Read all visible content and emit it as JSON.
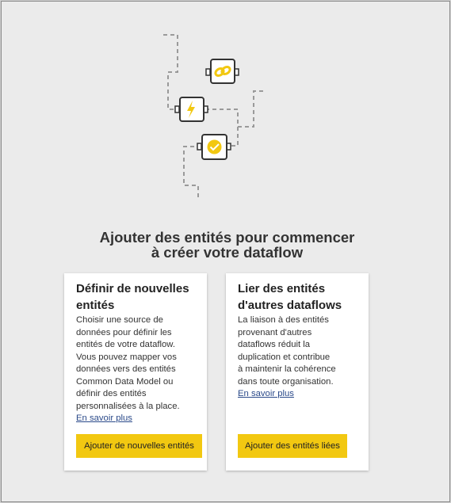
{
  "heading": {
    "line1": "Ajouter des entités pour commencer",
    "line2": "à créer votre dataflow"
  },
  "cards": [
    {
      "title_line1": "Définir de nouvelles",
      "title_line2": "entités",
      "desc_lines": [
        "Choisir une source de",
        "données pour définir les",
        "entités de votre dataflow.",
        "Vous pouvez mapper vos",
        "données vers des entités",
        "Common Data Model ou",
        "définir des entités",
        "personnalisées à la place."
      ],
      "link": "En savoir plus",
      "button": "Ajouter de nouvelles entités"
    },
    {
      "title_line1": "Lier des entités",
      "title_line2": "d'autres dataflows",
      "desc_lines": [
        "La liaison à des entités",
        "provenant d'autres",
        "dataflows réduit la",
        "duplication et contribue",
        "à maintenir la cohérence",
        "dans toute organisation."
      ],
      "link": "En savoir plus",
      "button": "Ajouter des entités liées"
    }
  ],
  "illustration": {
    "icons": [
      "link-icon",
      "lightning-icon",
      "checkmark-badge-icon"
    ],
    "accent": "#f2c811",
    "line_color": "#9a9a9a"
  }
}
